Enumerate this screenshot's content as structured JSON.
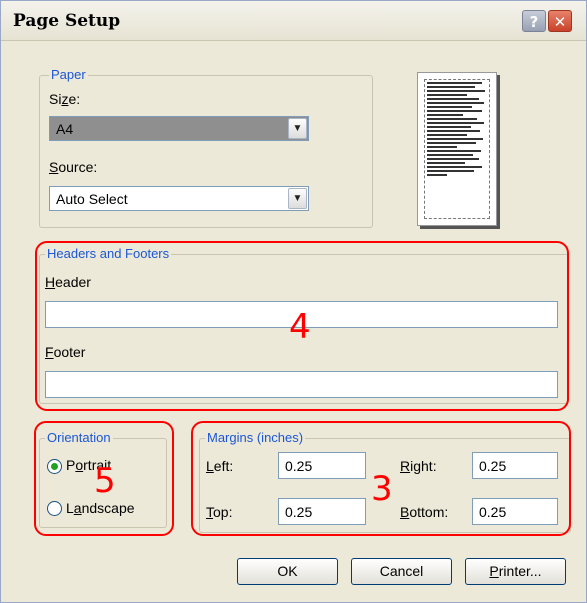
{
  "window": {
    "title": "Page Setup",
    "help_glyph": "?",
    "close_glyph": "✕"
  },
  "paper": {
    "group_title": "Paper",
    "size_label": "Size:",
    "size_value": "A4",
    "source_label": "Source:",
    "source_value": "Auto Select",
    "dropdown_glyph": "▼"
  },
  "headers_footers": {
    "group_title": "Headers and Footers",
    "header_label": "Header",
    "header_value": "",
    "footer_label": "Footer",
    "footer_value": ""
  },
  "orientation": {
    "group_title": "Orientation",
    "options": [
      "Portrait",
      "Landscape"
    ],
    "selected": "Portrait"
  },
  "margins": {
    "group_title": "Margins (inches)",
    "left_label": "Left:",
    "left_value": "0.25",
    "right_label": "Right:",
    "right_value": "0.25",
    "top_label": "Top:",
    "top_value": "0.25",
    "bottom_label": "Bottom:",
    "bottom_value": "0.25"
  },
  "buttons": {
    "ok": "OK",
    "cancel": "Cancel",
    "printer": "Printer..."
  },
  "annotations": {
    "headers_footers": "4",
    "margins": "3",
    "orientation": "5",
    "color": "#ff0000"
  }
}
